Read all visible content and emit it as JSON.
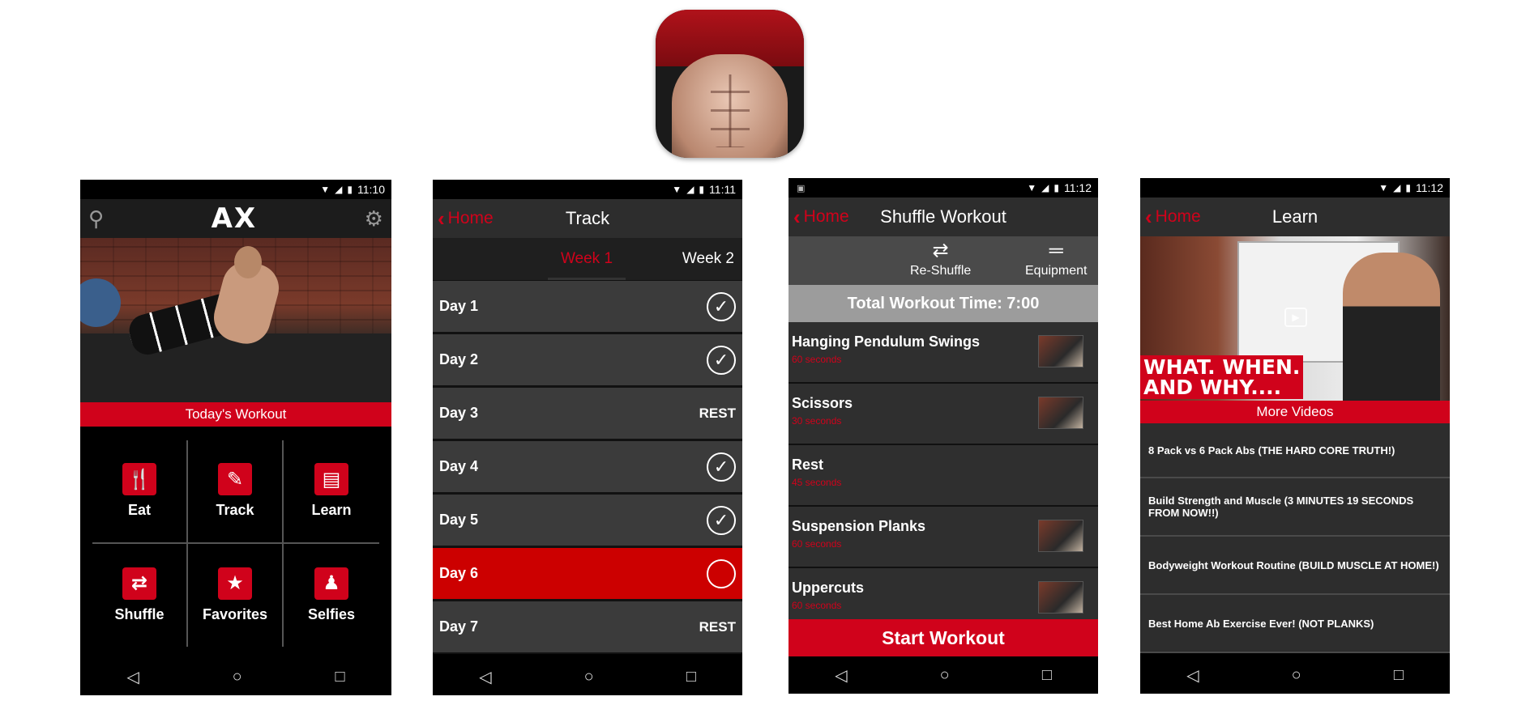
{
  "colors": {
    "accent": "#d0021b",
    "dark": "#2d2d2d",
    "rowBg": "#3b3b3b"
  },
  "phone1": {
    "status": {
      "time": "11:10"
    },
    "header": {
      "logo": "AX",
      "search_icon": "search-icon",
      "settings_icon": "gear-icon"
    },
    "banner": "Today's Workout",
    "tiles": [
      {
        "label": "Eat",
        "icon": "utensils-icon"
      },
      {
        "label": "Track",
        "icon": "pencil-icon"
      },
      {
        "label": "Learn",
        "icon": "book-icon"
      },
      {
        "label": "Shuffle",
        "icon": "shuffle-icon"
      },
      {
        "label": "Favorites",
        "icon": "star-icon"
      },
      {
        "label": "Selfies",
        "icon": "person-icon"
      }
    ]
  },
  "phone2": {
    "status": {
      "time": "11:11"
    },
    "back": "Home",
    "title": "Track",
    "tabs": [
      "Week 1",
      "Week 2"
    ],
    "days": [
      {
        "label": "Day 1",
        "status": "done"
      },
      {
        "label": "Day 2",
        "status": "done"
      },
      {
        "label": "Day 3",
        "status": "REST"
      },
      {
        "label": "Day 4",
        "status": "done"
      },
      {
        "label": "Day 5",
        "status": "done"
      },
      {
        "label": "Day 6",
        "status": "current"
      },
      {
        "label": "Day 7",
        "status": "REST"
      }
    ]
  },
  "phone3": {
    "status": {
      "time": "11:12"
    },
    "back": "Home",
    "title": "Shuffle Workout",
    "actions": {
      "reshuffle": "Re-Shuffle",
      "equipment": "Equipment"
    },
    "total": "Total Workout Time: 7:00",
    "exercises": [
      {
        "name": "Hanging Pendulum Swings",
        "duration": "60 seconds",
        "thumb": true
      },
      {
        "name": "Scissors",
        "duration": "30 seconds",
        "thumb": true
      },
      {
        "name": "Rest",
        "duration": "45 seconds",
        "thumb": false
      },
      {
        "name": "Suspension Planks",
        "duration": "60 seconds",
        "thumb": true
      },
      {
        "name": "Uppercuts",
        "duration": "60 seconds",
        "thumb": true
      }
    ],
    "start": "Start Workout"
  },
  "phone4": {
    "status": {
      "time": "11:12"
    },
    "back": "Home",
    "title": "Learn",
    "video_overlay": [
      "WHAT. WHEN.",
      "AND WHY...."
    ],
    "more_videos": "More Videos",
    "videos": [
      "8 Pack vs 6 Pack Abs (THE HARD CORE TRUTH!)",
      "Build Strength and Muscle (3 MINUTES 19 SECONDS FROM NOW!!)",
      "Bodyweight Workout Routine (BUILD MUSCLE AT HOME!)",
      "Best Home Ab Exercise Ever! (NOT PLANKS)"
    ]
  }
}
